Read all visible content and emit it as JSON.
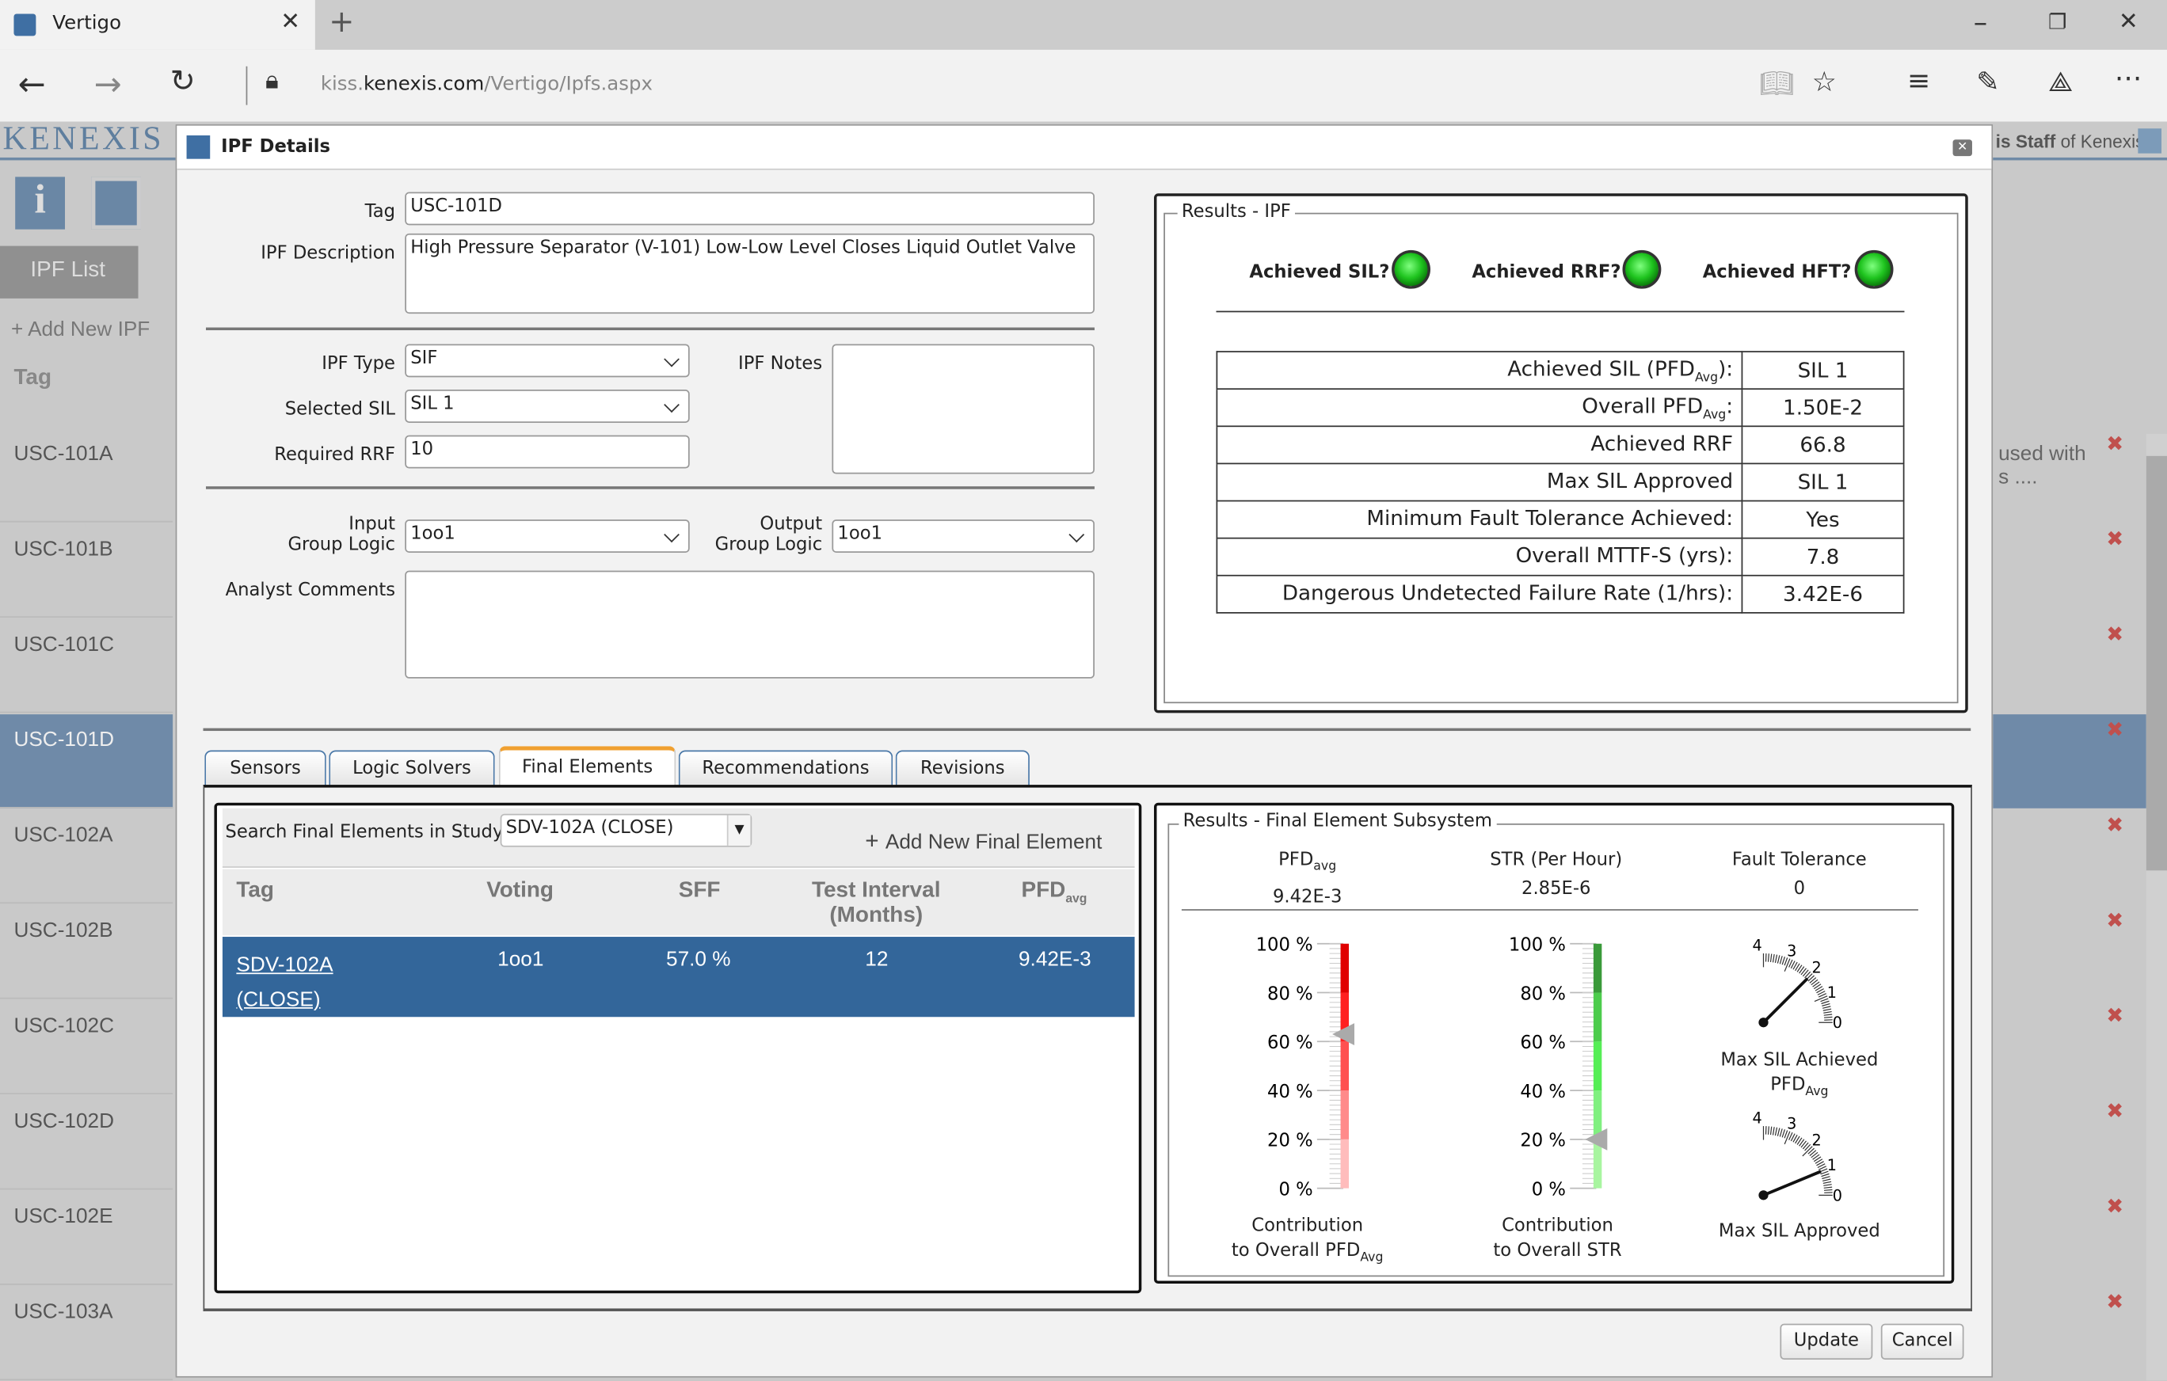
{
  "browser": {
    "tab_title": "Vertigo",
    "url_prefix": "kiss.",
    "url_domain": "kenexis.com",
    "url_path": "/Vertigo/Ipfs.aspx"
  },
  "app": {
    "logo": "KENEXIS",
    "user_bold": "is Staff",
    "user_rest": " of Kenexis",
    "ipf_list_tab": "IPF List",
    "add_new_ipf": "Add New IPF",
    "tag_header": "Tag",
    "rows": [
      "USC-101A",
      "USC-101B",
      "USC-101C",
      "USC-101D",
      "USC-102A",
      "USC-102B",
      "USC-102C",
      "USC-102D",
      "USC-102E",
      "USC-103A"
    ],
    "selected_row": "USC-101D",
    "desc_snippet_1": "used with",
    "desc_snippet_2": "s ...."
  },
  "modal": {
    "title": "IPF Details",
    "form": {
      "tag_label": "Tag",
      "tag_value": "USC-101D",
      "desc_label": "IPF Description",
      "desc_value": "High Pressure Separator (V-101) Low-Low Level Closes Liquid Outlet Valve",
      "type_label": "IPF Type",
      "type_value": "SIF",
      "sil_label": "Selected SIL",
      "sil_value": "SIL 1",
      "rrf_label": "Required RRF",
      "rrf_value": "10",
      "notes_label": "IPF Notes",
      "notes_value": "",
      "input_label_1": "Input",
      "input_label_2": "Group Logic",
      "input_value": "1oo1",
      "output_label_1": "Output",
      "output_label_2": "Group Logic",
      "output_value": "1oo1",
      "comments_label": "Analyst Comments",
      "comments_value": ""
    },
    "results_ipf": {
      "legend": "Results - IPF",
      "achieved_sil": "Achieved SIL?",
      "achieved_rrf": "Achieved RRF?",
      "achieved_hft": "Achieved HFT?",
      "table": [
        {
          "label": "Achieved SIL (PFD",
          "sub": "Avg",
          "tail": "):",
          "value": "SIL 1"
        },
        {
          "label": "Overall PFD",
          "sub": "Avg",
          "tail": ":",
          "value": "1.50E-2"
        },
        {
          "label": "Achieved RRF",
          "sub": "",
          "tail": "",
          "value": "66.8"
        },
        {
          "label": "Max SIL Approved",
          "sub": "",
          "tail": "",
          "value": "SIL 1"
        },
        {
          "label": "Minimum Fault Tolerance Achieved:",
          "sub": "",
          "tail": "",
          "value": "Yes"
        },
        {
          "label": "Overall MTTF-S (yrs):",
          "sub": "",
          "tail": "",
          "value": "7.8"
        },
        {
          "label": "Dangerous Undetected Failure Rate (1/hrs):",
          "sub": "",
          "tail": "",
          "value": "3.42E-6"
        }
      ]
    },
    "tabs": [
      "Sensors",
      "Logic Solvers",
      "Final Elements",
      "Recommendations",
      "Revisions"
    ],
    "active_tab": "Final Elements",
    "final_elements": {
      "search_label": "Search Final Elements in Study:",
      "search_value": "SDV-102A (CLOSE)",
      "add_label": "Add New Final Element",
      "headers": {
        "tag": "Tag",
        "voting": "Voting",
        "sff": "SFF",
        "ti_1": "Test Interval",
        "ti_2": "(Months)",
        "pfd": "PFD",
        "pfd_sub": "avg"
      },
      "row": {
        "tag_1": "SDV-102A",
        "tag_2": "(CLOSE)",
        "voting": "1oo1",
        "sff": "57.0 %",
        "ti": "12",
        "pfd": "9.42E-3"
      }
    },
    "results_fe": {
      "legend": "Results - Final Element Subsystem",
      "pfd_label": "PFD",
      "pfd_sub": "avg",
      "pfd_value": "9.42E-3",
      "str_label": "STR (Per Hour)",
      "str_value": "2.85E-6",
      "ft_label": "Fault Tolerance",
      "ft_value": "0",
      "ticks": [
        "100 %",
        "80 %",
        "60 %",
        "40 %",
        "20 %",
        "0 %"
      ],
      "pfd_contribution_pct": 63,
      "str_contribution_pct": 20,
      "pfd_bar_label_1": "Contribution",
      "pfd_bar_label_2": "to Overall PFD",
      "pfd_bar_sub": "Avg",
      "str_bar_label_1": "Contribution",
      "str_bar_label_2": "to Overall STR",
      "gauge_ticks": [
        "4",
        "3",
        "2",
        "1",
        "0"
      ],
      "gauge1_value": 2,
      "gauge1_label_1": "Max SIL Achieved",
      "gauge1_label_2": "PFD",
      "gauge1_sub": "Avg",
      "gauge2_value": 1,
      "gauge2_label": "Max SIL Approved",
      "colors": {
        "red": [
          "#ffbcbc",
          "#ff8a8a",
          "#ff5050",
          "#ff2020",
          "#e00000"
        ],
        "green": [
          "#a8f5a0",
          "#80f080",
          "#55ee55",
          "#4ccc4c",
          "#3a9a3a"
        ]
      }
    },
    "update": "Update",
    "cancel": "Cancel"
  }
}
